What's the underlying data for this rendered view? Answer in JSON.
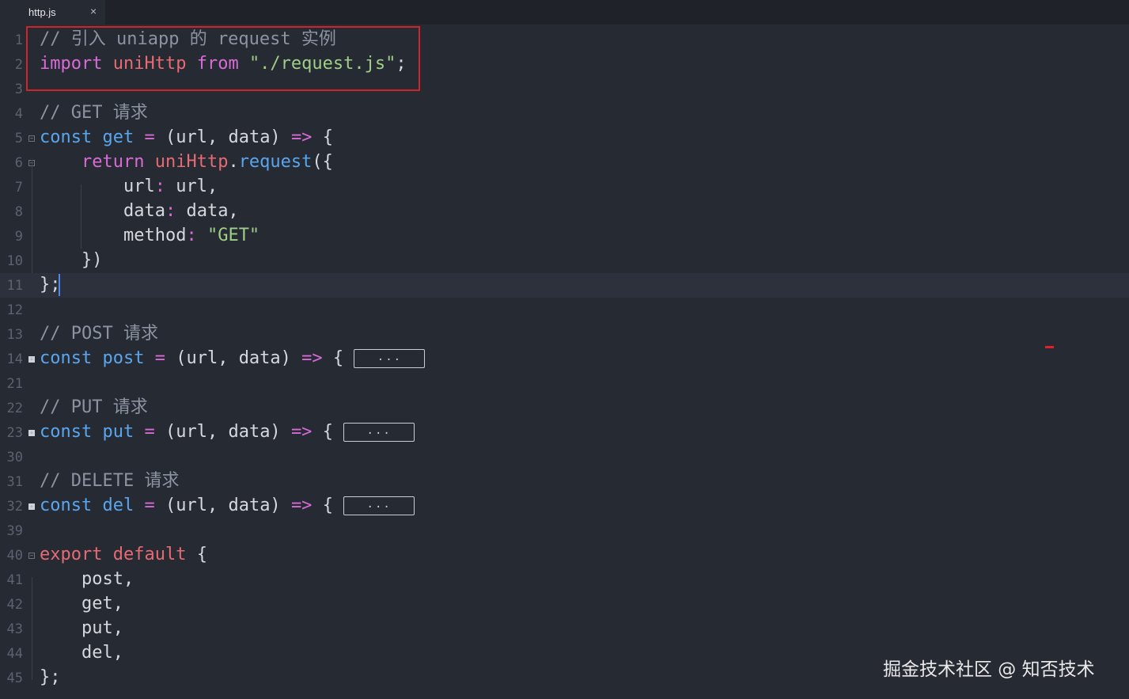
{
  "tab": {
    "label": "http.js",
    "close": "×"
  },
  "lines": [
    {
      "num": "1",
      "c1": "// 引入 uniapp 的 request 实例"
    },
    {
      "num": "2",
      "c1": "import",
      "c2": "uniHttp",
      "c3": "from",
      "c4": "\"./request.js\"",
      "c5": ";"
    },
    {
      "num": "3"
    },
    {
      "num": "4",
      "c1": "// GET 请求"
    },
    {
      "num": "5",
      "c1": "const",
      "c2": "get",
      "c3": "=",
      "c4": "(url, data)",
      "c5": "=>",
      "c6": "{"
    },
    {
      "num": "6",
      "c1": "return",
      "c2": "uniHttp",
      "c3": ".",
      "c4": "request",
      "c5": "({"
    },
    {
      "num": "7",
      "c1": "url",
      "c2": ":",
      "c3": "url,"
    },
    {
      "num": "8",
      "c1": "data",
      "c2": ":",
      "c3": "data,"
    },
    {
      "num": "9",
      "c1": "method",
      "c2": ":",
      "c3": "\"GET\""
    },
    {
      "num": "10",
      "c1": "})"
    },
    {
      "num": "11",
      "c1": "};"
    },
    {
      "num": "12"
    },
    {
      "num": "13",
      "c1": "// POST 请求"
    },
    {
      "num": "14",
      "c1": "const",
      "c2": "post",
      "c3": "=",
      "c4": "(url, data)",
      "c5": "=>",
      "c6": "{",
      "fold": "..."
    },
    {
      "num": "21"
    },
    {
      "num": "22",
      "c1": "// PUT 请求"
    },
    {
      "num": "23",
      "c1": "const",
      "c2": "put",
      "c3": "=",
      "c4": "(url, data)",
      "c5": "=>",
      "c6": "{",
      "fold": "..."
    },
    {
      "num": "30"
    },
    {
      "num": "31",
      "c1": "// DELETE 请求"
    },
    {
      "num": "32",
      "c1": "const",
      "c2": "del",
      "c3": "=",
      "c4": "(url, data)",
      "c5": "=>",
      "c6": "{",
      "fold": "..."
    },
    {
      "num": "39"
    },
    {
      "num": "40",
      "c1": "export",
      "c2": "default",
      "c3": "{"
    },
    {
      "num": "41",
      "c1": "post,"
    },
    {
      "num": "42",
      "c1": "get,"
    },
    {
      "num": "43",
      "c1": "put,"
    },
    {
      "num": "44",
      "c1": "del,"
    },
    {
      "num": "45",
      "c1": "};"
    }
  ],
  "watermark": "掘金技术社区 @ 知否技术",
  "colors": {
    "highlight": "#d2232a",
    "cursor": "#4c86e8",
    "keyword": "#d96ad7",
    "ident": "#5aa6ee",
    "import_name": "#e86a73",
    "string": "#9fce86"
  }
}
